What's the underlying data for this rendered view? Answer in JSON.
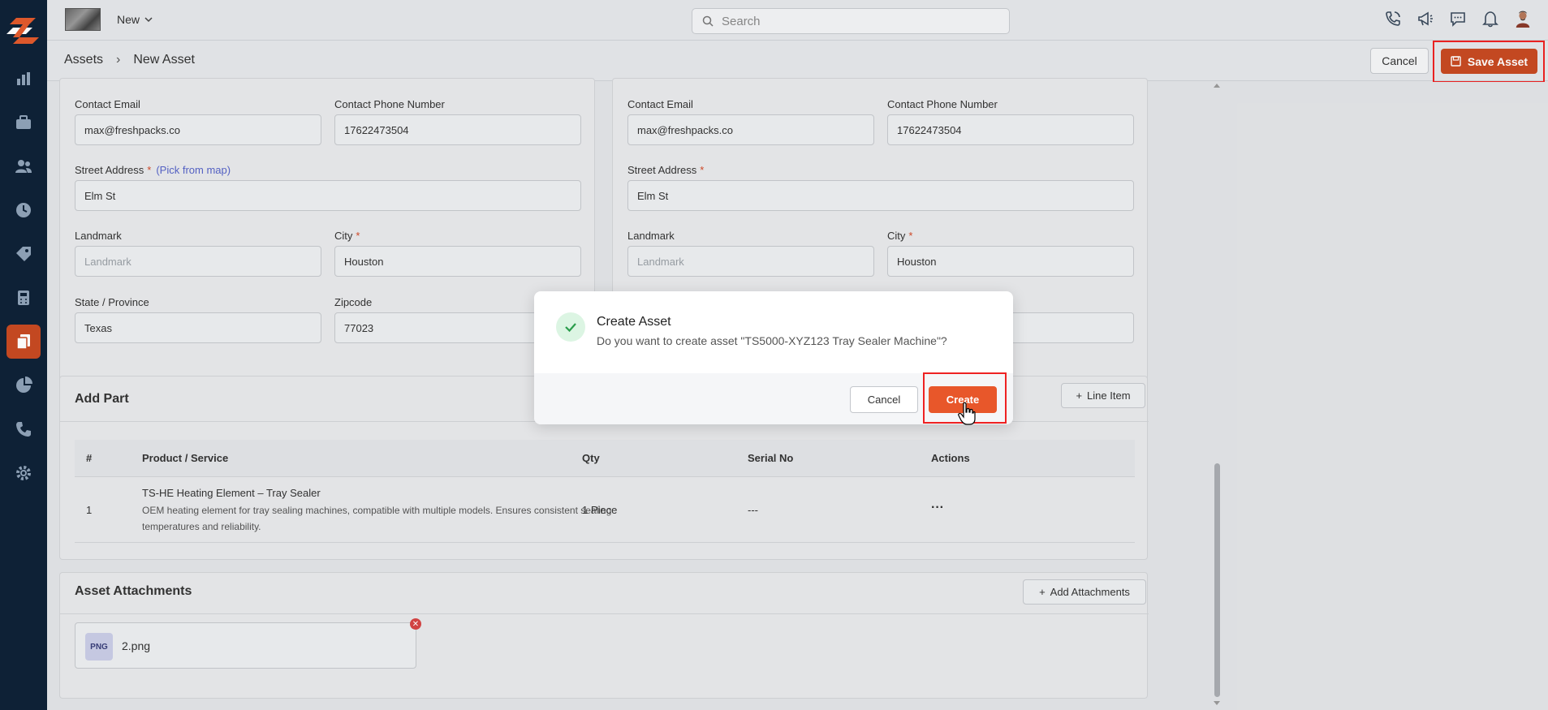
{
  "topbar": {
    "new_label": "New",
    "search_placeholder": "Search"
  },
  "breadcrumb": {
    "root": "Assets",
    "separator": "›",
    "current": "New Asset"
  },
  "header_actions": {
    "cancel_label": "Cancel",
    "save_label": "Save Asset"
  },
  "left_address": {
    "contact_email_label": "Contact Email",
    "contact_email_value": "max@freshpacks.co",
    "contact_phone_label": "Contact Phone Number",
    "contact_phone_value": "17622473504",
    "street_label": "Street Address",
    "required_mark": "*",
    "pick_from_map": "(Pick from map)",
    "street_value": "Elm St",
    "landmark_label": "Landmark",
    "landmark_placeholder": "Landmark",
    "city_label": "City",
    "city_value": "Houston",
    "state_label": "State / Province",
    "state_value": "Texas",
    "zip_label": "Zipcode",
    "zip_value": "77023"
  },
  "right_address": {
    "contact_email_label": "Contact Email",
    "contact_email_value": "max@freshpacks.co",
    "contact_phone_label": "Contact Phone Number",
    "contact_phone_value": "17622473504",
    "street_label": "Street Address",
    "street_value": "Elm St",
    "landmark_label": "Landmark",
    "landmark_placeholder": "Landmark",
    "city_label": "City",
    "city_value": "Houston"
  },
  "add_part": {
    "title": "Add Part",
    "line_item_label": "Line Item",
    "columns": [
      "#",
      "Product / Service",
      "Qty",
      "Serial No",
      "Actions"
    ],
    "rows": [
      {
        "num": "1",
        "name": "TS-HE Heating Element – Tray Sealer",
        "description": "OEM heating element for tray sealing machines, compatible with multiple models. Ensures consistent sealing temperatures and reliability.",
        "qty": "1 Piece",
        "serial": "---",
        "actions": "···"
      }
    ]
  },
  "attachments": {
    "title": "Asset Attachments",
    "add_label": "Add Attachments",
    "files": [
      {
        "type": "PNG",
        "name": "2.png"
      }
    ]
  },
  "modal": {
    "title": "Create Asset",
    "message": "Do you want to create asset \"TS5000-XYZ123 Tray Sealer Machine\"?",
    "cancel_label": "Cancel",
    "create_label": "Create"
  },
  "colors": {
    "sidebar": "#0f2238",
    "brand": "#c74a22",
    "create": "#e8572a",
    "highlight": "#e22222"
  },
  "icons": [
    "logo-icon",
    "chart-icon",
    "briefcase-icon",
    "users-icon",
    "clock-icon",
    "tag-icon",
    "calculator-icon",
    "documents-icon",
    "pie-chart-icon",
    "phone-icon",
    "gear-icon",
    "search-icon",
    "call-icon",
    "megaphone-icon",
    "chat-icon",
    "bell-icon",
    "avatar",
    "check-icon",
    "plus-icon",
    "save-icon"
  ]
}
